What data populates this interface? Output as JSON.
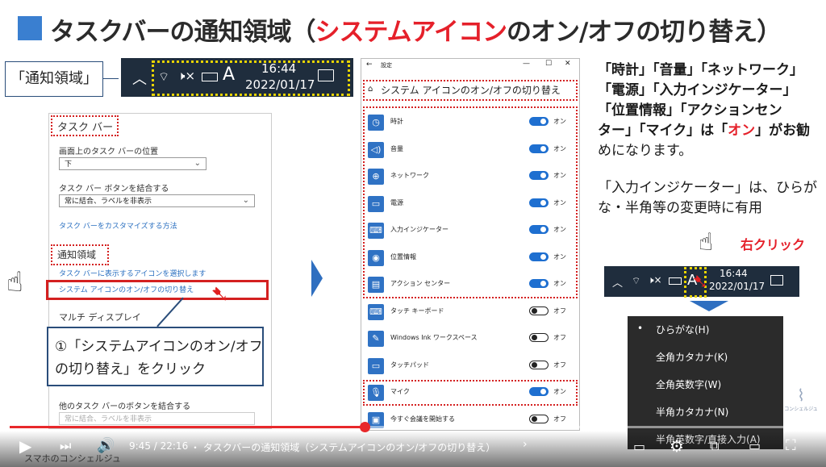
{
  "title": {
    "prefix": "タスクバーの通知領域（",
    "highlight": "システムアイコン",
    "suffix": "のオン/オフの切り替え）"
  },
  "notif_label": "「通知領域」",
  "top_taskbar": {
    "time": "16:44",
    "date": "2022/01/17",
    "ime": "A"
  },
  "left_settings": {
    "heading": "タスク バー",
    "position_label": "画面上のタスク バーの位置",
    "position_value": "下",
    "combine_label": "タスク バー ボタンを結合する",
    "combine_value": "常に結合、ラベルを非表示",
    "customize_link": "タスク バーをカスタマイズする方法",
    "notif_heading": "通知領域",
    "select_icons_link": "タスク バーに表示するアイコンを選択します",
    "system_icons_link": "システム アイコンのオン/オフの切り替え",
    "multi_display": "マルチ ディスプレイ",
    "other_combine_label": "他のタスク バーのボタンを結合する",
    "other_combine_value": "常に結合、ラベルを非表示"
  },
  "callout": {
    "line1": "①「システムアイコンのオン/オフ",
    "line2": "の切り替え」をクリック"
  },
  "mid_settings": {
    "window_title": "設定",
    "page_title": "システム アイコンのオン/オフの切り替え",
    "rows": [
      {
        "label": "時計",
        "state": "オン"
      },
      {
        "label": "音量",
        "state": "オン"
      },
      {
        "label": "ネットワーク",
        "state": "オン"
      },
      {
        "label": "電源",
        "state": "オン"
      },
      {
        "label": "入力インジケーター",
        "state": "オン"
      },
      {
        "label": "位置情報",
        "state": "オン"
      },
      {
        "label": "アクション センター",
        "state": "オン"
      },
      {
        "label": "タッチ キーボード",
        "state": "オフ"
      },
      {
        "label": "Windows Ink ワークスペース",
        "state": "オフ"
      },
      {
        "label": "タッチパッド",
        "state": "オフ"
      },
      {
        "label": "マイク",
        "state": "オン"
      },
      {
        "label": "今すぐ会議を開始する",
        "state": "オフ"
      }
    ]
  },
  "right_text": {
    "l1": "「時計」「音量」「ネットワーク」",
    "l2": "「電源」「入力インジケーター」",
    "l3": "「位置情報」「アクションセン",
    "l4a": "ター」「マイク」は「",
    "l4b": "オン",
    "l4c": "」がお勧",
    "l5": "めになります。",
    "p2l1": "「入力インジケーター」は、ひらが",
    "p2l2": "な・半角等の変更時に有用"
  },
  "right_click_label": "右クリック",
  "small_taskbar": {
    "time": "16:44",
    "date": "2022/01/17",
    "ime": "A"
  },
  "ime_menu": [
    "ひらがな(H)",
    "全角カタカナ(K)",
    "全角英数字(W)",
    "半角カタカナ(N)",
    "半角英数字/直接入力(A)"
  ],
  "video": {
    "time": "9:45 / 22:16",
    "chapter": "・ タスクバーの通知領域（システムアイコンのオン/オフの切り替え）",
    "channel": "スマホのコンシェルジュ",
    "watermark": "コンシェルジュ"
  }
}
